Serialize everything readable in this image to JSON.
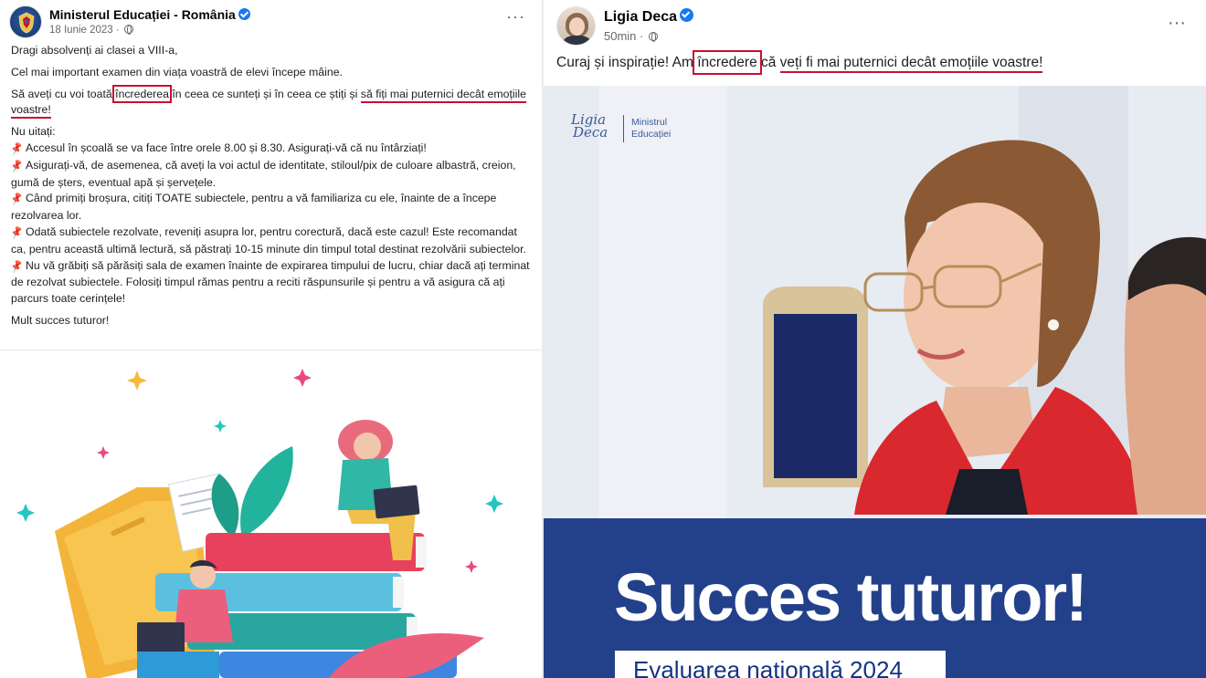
{
  "left_post": {
    "author": "Ministerul Educației - România",
    "date": "18 Iunie 2023",
    "more": "···",
    "p1": "Dragi absolvenți ai clasei a VIII-a,",
    "p2": "Cel mai important examen din viața voastră de elevi începe mâine.",
    "p3_a": "Să aveți cu voi toată ",
    "p3_boxed": "încrederea",
    "p3_b": " în ceea ce sunteți și în ceea ce știți și ",
    "p3_underlined": "să fiți mai puternici decât emoțiile voastre!",
    "reminder_title": "Nu uitați:",
    "items": [
      "Accesul în școală se va face între orele 8.00 și 8.30. Asigurați-vă că nu întârziați!",
      "Asigurați-vă, de asemenea, că aveți la voi actul de identitate, stiloul/pix de culoare albastră, creion, gumă de șters, eventual apă și șervețele.",
      "Când primiți broșura, citiți TOATE subiectele, pentru a vă familiariza cu ele, înainte de a începe rezolvarea lor.",
      "Odată subiectele rezolvate, reveniți asupra lor, pentru corectură, dacă este cazul! Este recomandat ca, pentru această ultimă lectură, să păstrați 10-15 minute din timpul total destinat rezolvării subiectelor.",
      "Nu vă grăbiți să părăsiți sala de examen înainte de expirarea timpului de lucru, chiar dacă ați terminat de rezolvat subiectele. Folosiți timpul rămas pentru a reciti răspunsurile și pentru a vă asigura că ați parcurs toate cerințele!"
    ],
    "closing": "Mult succes tuturor!",
    "pin_icon": "pushpin-icon"
  },
  "right_post": {
    "author": "Ligia Deca",
    "time": "50min",
    "more": "···",
    "text_a": "Curaj și inspirație! Am ",
    "text_boxed": "încredere",
    "text_b": " că ",
    "text_underlined": "veți fi mai puternici decât emoțiile voastre!",
    "logo_script_1": "Ligia",
    "logo_script_2": "Deca",
    "logo_ministry_1": "Ministrul",
    "logo_ministry_2": "Educației",
    "banner_title": "Succes tuturor!",
    "banner_subtitle": "Evaluarea națională 2024"
  },
  "colors": {
    "highlight": "#c8102e",
    "facebook_blue": "#1877f2",
    "banner_blue": "#133482"
  }
}
